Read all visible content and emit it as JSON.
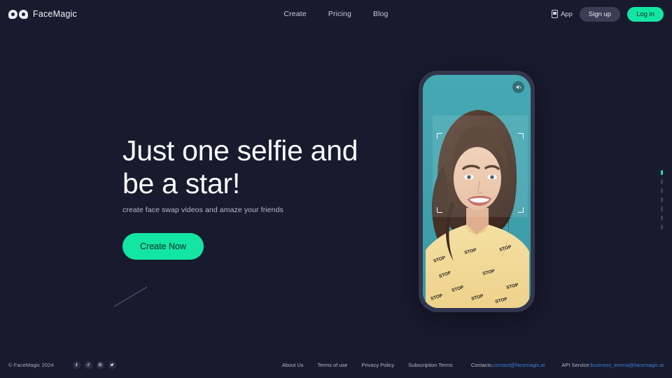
{
  "theme": {
    "background": "#181a2e",
    "accent": "#13e5a3",
    "text_primary": "#fbfbfd",
    "text_muted": "#b4b7c7",
    "link_blue": "#3d7fd6",
    "phone_frame": "#33364f",
    "screen_bg": "#3fa3ae"
  },
  "header": {
    "brand": "FaceMagic",
    "nav": [
      {
        "label": "Create",
        "name": "nav-create"
      },
      {
        "label": "Pricing",
        "name": "nav-pricing"
      },
      {
        "label": "Blog",
        "name": "nav-blog"
      }
    ],
    "app_label": "App",
    "signup_label": "Sign up",
    "login_label": "Log in"
  },
  "hero": {
    "headline": "Just one selfie and\nbe a star!",
    "subhead": "create face swap videos and amaze your friends",
    "cta_label": "Create Now"
  },
  "phone": {
    "mute_icon": "mute-speaker-icon",
    "face_frame_label": "face-detection-frame",
    "shirt_text": "STOP"
  },
  "pager": {
    "dots": 7,
    "active_index": 0
  },
  "footer": {
    "copyright": "© FaceMagic 2024",
    "socials": [
      {
        "name": "facebook-icon",
        "glyph": "f"
      },
      {
        "name": "tiktok-icon",
        "glyph": "♪"
      },
      {
        "name": "instagram-icon",
        "glyph": "▣"
      },
      {
        "name": "twitter-icon",
        "glyph": "🐦"
      }
    ],
    "links": [
      {
        "label": "About Us",
        "name": "footer-link-about-us"
      },
      {
        "label": "Terms of use",
        "name": "footer-link-terms-of-use"
      },
      {
        "label": "Privacy Policy",
        "name": "footer-link-privacy-policy"
      },
      {
        "label": "Subscription Terms",
        "name": "footer-link-subscription-terms"
      }
    ],
    "contacts_label": "Contacts:",
    "contacts_email": "contact@facemagic.ai",
    "api_label": "API Service:",
    "api_email": "business_emma@facemagic.ai"
  }
}
